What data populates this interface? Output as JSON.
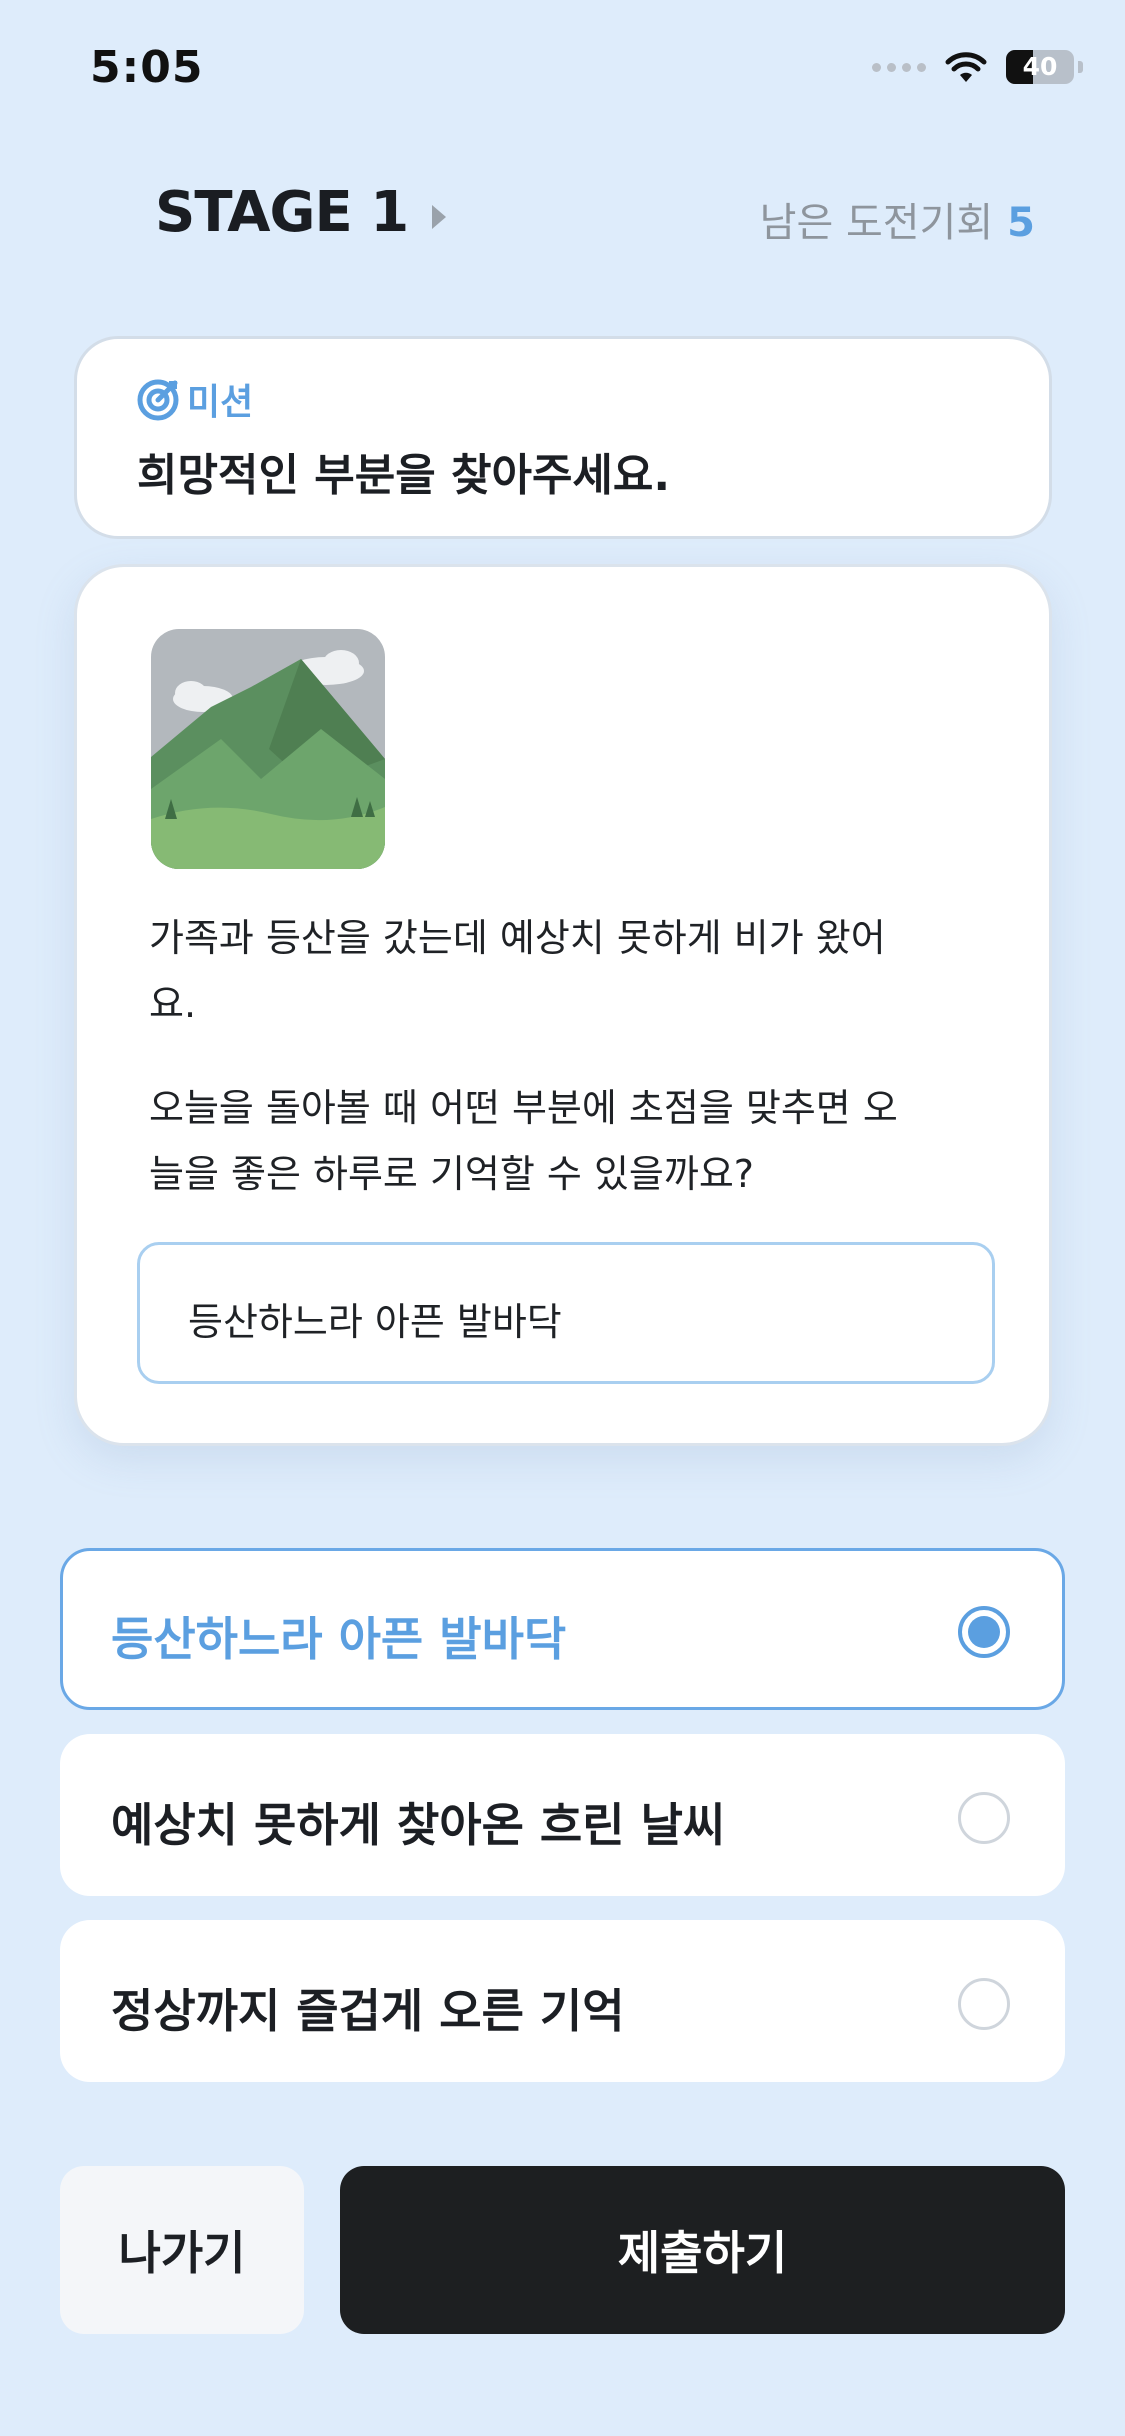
{
  "status_bar": {
    "time": "5:05",
    "battery_level": "40",
    "icons": [
      "signal-dots-icon",
      "wifi-icon",
      "battery-icon"
    ]
  },
  "header": {
    "stage_title": "STAGE 1",
    "remaining_label": "남은 도전기회",
    "remaining_count": "5"
  },
  "mission": {
    "label": "미션",
    "icon": "target-icon",
    "text": "희망적인 부분을 찾아주세요."
  },
  "question": {
    "image_icon": "mountain-landscape-image",
    "paragraph_1": "가족과 등산을 갔는데 예상치 못하게 비가 왔어요.",
    "paragraph_2": "오늘을 돌아볼 때 어떤 부분에 초점을 맞추면 오늘을 좋은 하루로 기억할 수 있을까요?",
    "answer": "등산하느라 아픈 발바닥"
  },
  "options": [
    {
      "label": "등산하느라 아픈 발바닥",
      "selected": true
    },
    {
      "label": "예상치 못하게 찾아온 흐린 날씨",
      "selected": false
    },
    {
      "label": "정상까지 즐겁게 오른 기억",
      "selected": false
    }
  ],
  "buttons": {
    "exit": "나가기",
    "submit": "제출하기"
  },
  "colors": {
    "background": "#deecfb",
    "accent": "#5b9fe0",
    "submit_bg": "#1d1f21"
  }
}
